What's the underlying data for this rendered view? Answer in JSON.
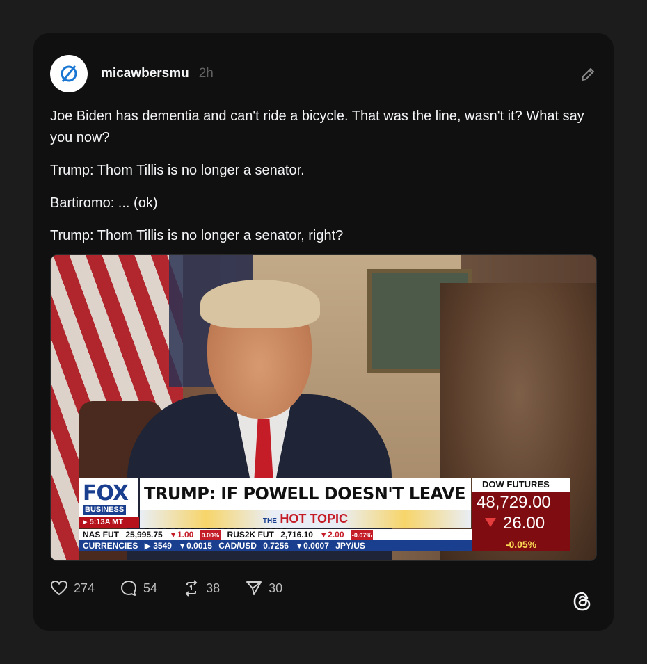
{
  "post": {
    "username": "micawbersmu",
    "time": "2h",
    "paragraphs": [
      "Joe Biden has dementia and can't ride a bicycle. That was the line, wasn't it? What say you now?",
      "Trump: Thom Tillis is no longer a senator.",
      "Bartiromo: ... (ok)",
      "Trump: Thom Tillis is no longer a senator, right?"
    ]
  },
  "media": {
    "logo_fox": "FOX",
    "logo_business": "BUSINESS",
    "logo_time": "▸ 5:13A MT",
    "headline": "TRUMP: IF POWELL DOESN'T LEAVE I WILL FIRE HIM",
    "hot_topic_prefix": "THE",
    "hot_topic": "HOT TOPIC",
    "dow_label": "DOW FUTURES",
    "dow_value": "48,729.00",
    "dow_change": "26.00",
    "dow_pct": "-0.05%",
    "ticker_row1": [
      "NAS FUT",
      "25,995.75",
      "▼1.00",
      "0.00%",
      "RUS2K FUT",
      "2,716.10",
      "▼2.00",
      "-0.07%"
    ],
    "ticker_row2": [
      "CURRENCIES",
      "▶ 3549",
      "▼0.0015",
      "CAD/USD",
      "0.7256",
      "▼0.0007",
      "JPY/US"
    ]
  },
  "actions": {
    "likes": "274",
    "comments": "54",
    "reposts": "38",
    "shares": "30"
  },
  "colors": {
    "background": "#1c1c1c",
    "card": "#101010",
    "text": "#f3f5f7",
    "muted": "#616161"
  }
}
